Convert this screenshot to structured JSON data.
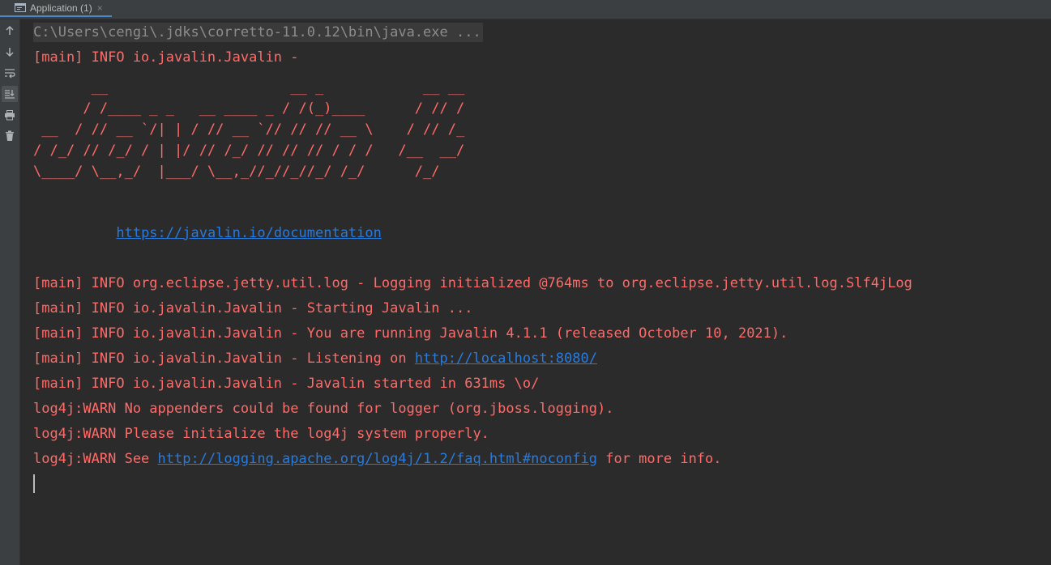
{
  "tab": {
    "label": "Application (1)",
    "close_label": "×"
  },
  "toolbar": {
    "buttons": [
      "arrow-up-icon",
      "arrow-down-icon",
      "soft-wrap-icon",
      "scroll-to-end-icon",
      "print-icon",
      "trash-icon"
    ]
  },
  "colors": {
    "error_text": "#ff6b68",
    "link": "#287bde",
    "command": "#8c8c8c",
    "background": "#2b2b2b"
  },
  "console": {
    "command": "C:\\Users\\cengi\\.jdks\\corretto-11.0.12\\bin\\java.exe ...",
    "line1": "[main] INFO io.javalin.Javalin - ",
    "banner": [
      "       __                      __ _            __ __",
      "      / /____ _ _   __ ____ _ / /(_)____      / // /",
      " __  / // __ `/| | / // __ `// // // __ \\    / // /_",
      "/ /_/ // /_/ / | |/ // /_/ // // // / / /   /__  __/",
      "\\____/ \\__,_/  |___/ \\__,_//_//_//_/ /_/      /_/"
    ],
    "doc_indent": "          ",
    "doc_link": "https://javalin.io/documentation",
    "log1": "[main] INFO org.eclipse.jetty.util.log - Logging initialized @764ms to org.eclipse.jetty.util.log.Slf4jLog",
    "log2": "[main] INFO io.javalin.Javalin - Starting Javalin ...",
    "log3": "[main] INFO io.javalin.Javalin - You are running Javalin 4.1.1 (released October 10, 2021).",
    "log4_prefix": "[main] INFO io.javalin.Javalin - Listening on ",
    "log4_link": "http://localhost:8080/",
    "log5": "[main] INFO io.javalin.Javalin - Javalin started in 631ms \\o/",
    "warn1": "log4j:WARN No appenders could be found for logger (org.jboss.logging).",
    "warn2": "log4j:WARN Please initialize the log4j system properly.",
    "warn3_prefix": "log4j:WARN See ",
    "warn3_link": "http://logging.apache.org/log4j/1.2/faq.html#noconfig",
    "warn3_suffix": " for more info."
  }
}
